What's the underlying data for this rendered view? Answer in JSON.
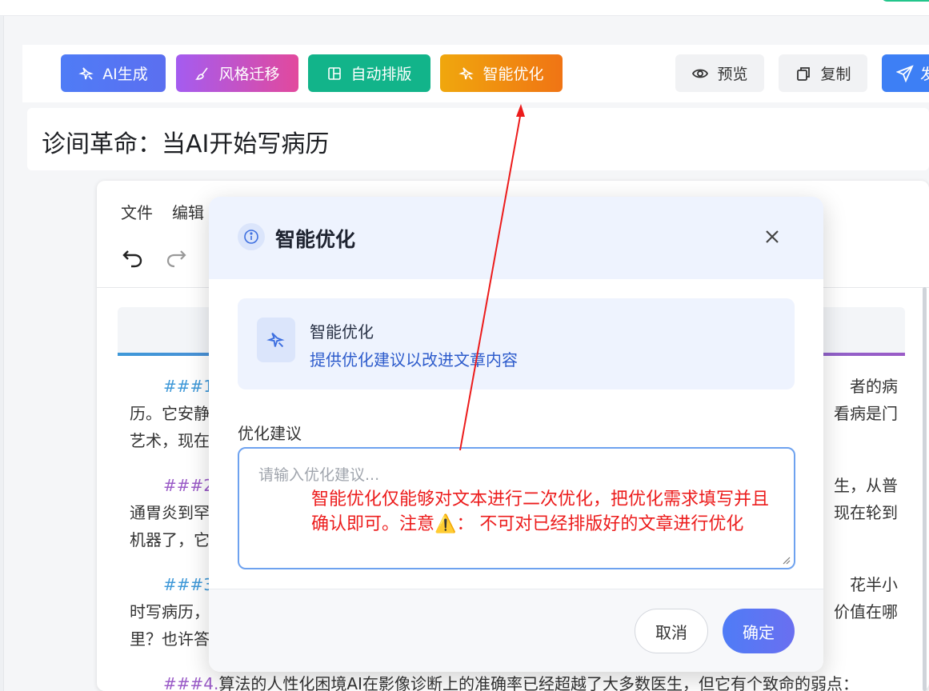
{
  "toolbar": {
    "ai_generate": "AI生成",
    "style_transfer": "风格迁移",
    "auto_layout": "自动排版",
    "smart_optimize": "智能优化",
    "preview": "预览",
    "copy": "复制",
    "send": "发"
  },
  "article": {
    "title": "诊间革命：当AI开始写病历"
  },
  "editor": {
    "menu": [
      "文件",
      "编辑"
    ],
    "paragraphs": [
      {
        "heading": "###1.",
        "heading_tail": "者的病",
        "line2_left": "历。它安静",
        "line2_right": "看病是门",
        "line3_left": "艺术，现在"
      },
      {
        "heading": "###2.",
        "heading_tail": "生，从普",
        "line2_left": "通胃炎到罕",
        "line2_right": "现在轮到",
        "line3_left": "机器了，它"
      },
      {
        "heading": "###3.",
        "heading_tail": "花半小",
        "line2_left": "时写病历，",
        "line2_right": "价值在哪",
        "line3_left": "里？也许答"
      },
      {
        "heading": "###4.",
        "line1": "算法的人性化困境AI在影像诊断上的准确率已经超越了大多数医生，但它有个致命的弱点："
      }
    ]
  },
  "modal": {
    "title": "智能优化",
    "card_title": "智能优化",
    "card_subtitle": "提供优化建议以改进文章内容",
    "field_label": "优化建议",
    "placeholder": "请输入优化建议...",
    "annotation": "智能优化仅能够对文本进行二次优化，把优化需求填写并且确认即可。注意⚠️： 不可对已经排版好的文章进行优化",
    "cancel": "取消",
    "confirm": "确定"
  },
  "colors": {
    "ai_button": "#4f7cf6",
    "style_button": "#c052c8",
    "layout_button": "#12b48a",
    "optimize_button": "#f08a10",
    "annotation_red": "#ec1c1c"
  }
}
